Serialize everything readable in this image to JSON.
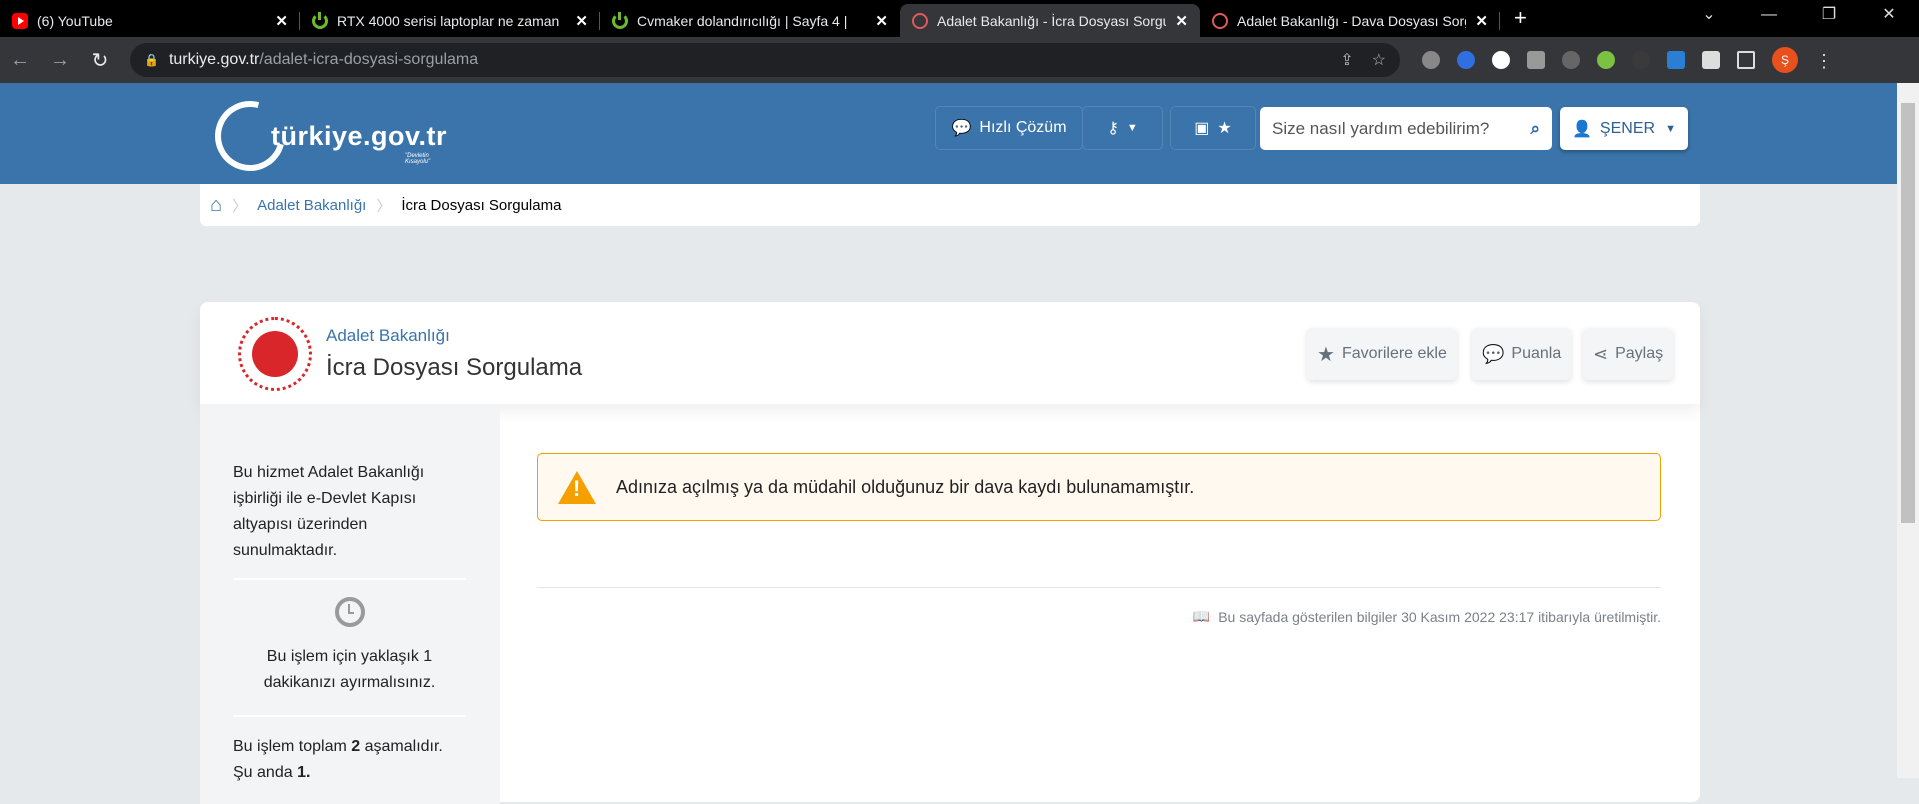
{
  "browser": {
    "tabs": [
      {
        "title": "(6) YouTube",
        "icon": "youtube-icon"
      },
      {
        "title": "RTX 4000 serisi laptoplar ne zaman",
        "icon": "power-icon"
      },
      {
        "title": "Cvmaker dolandırıcılığı | Sayfa 4 |",
        "icon": "power-icon"
      },
      {
        "title": "Adalet Bakanlığı - İcra Dosyası Sorgulama",
        "icon": "edevlet-icon",
        "active": true
      },
      {
        "title": "Adalet Bakanlığı - Dava Dosyası Sorgulama",
        "icon": "edevlet-icon"
      }
    ],
    "url_host": "turkiye.gov.tr",
    "url_path": "/adalet-icra-dosyasi-sorgulama",
    "profile_initial": "Ş"
  },
  "header": {
    "logo": "türkiye.gov.tr",
    "slogan": "\"Devletin Kısayolu\"",
    "quick_solution": "Hızlı Çözüm",
    "search_placeholder": "Size nasıl yardım edebilirim?",
    "user": "ŞENER"
  },
  "breadcrumb": {
    "items": [
      "Adalet Bakanlığı",
      "İcra Dosyası Sorgulama"
    ]
  },
  "page": {
    "institution": "Adalet Bakanlığı",
    "title": "İcra Dosyası Sorgulama",
    "actions": {
      "favorite": "Favorilere ekle",
      "rate": "Puanla",
      "share": "Paylaş"
    }
  },
  "sidebar": {
    "info": "Bu hizmet Adalet Bakanlığı işbirliği ile e-Devlet Kapısı altyapısı üzerinden sunulmaktadır.",
    "duration": "Bu işlem için yaklaşık 1 dakikanızı ayırmalısınız.",
    "steps_pre": "Bu işlem toplam ",
    "steps_total": "2",
    "steps_mid": " aşamalıdır. Şu anda ",
    "steps_current": "1."
  },
  "alert": {
    "message": "Adınıza açılmış ya da müdahil olduğunuz bir dava kaydı bulunamamıştır."
  },
  "footer": {
    "generated": "Bu sayfada gösterilen bilgiler 30 Kasım 2022 23:17 itibarıyla üretilmiştir."
  }
}
